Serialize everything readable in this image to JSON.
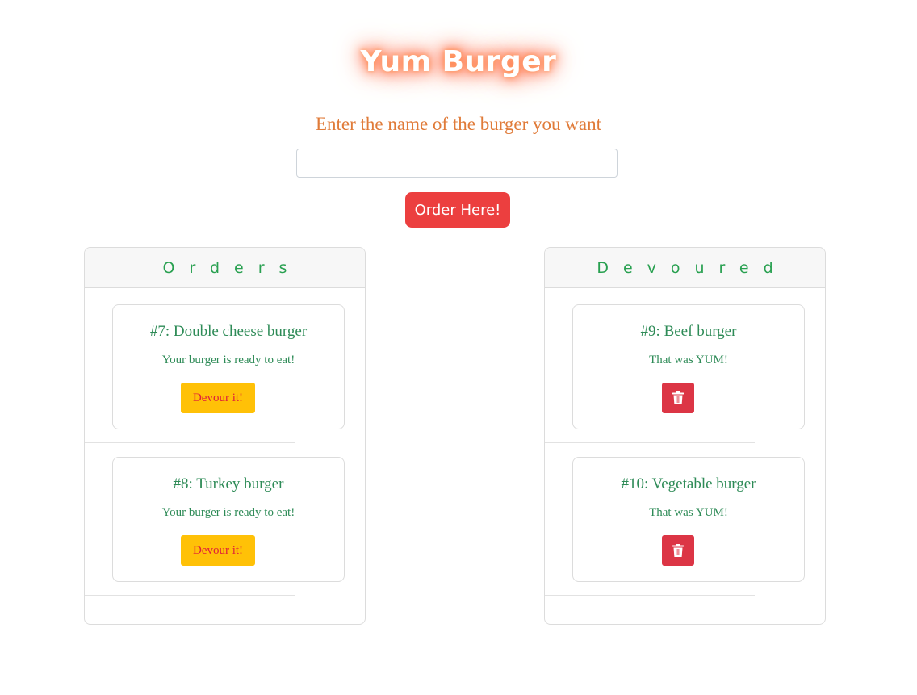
{
  "app": {
    "title": "Yum Burger"
  },
  "order_form": {
    "prompt": "Enter the name of the burger you want",
    "input_value": "",
    "input_placeholder": "",
    "submit_label": "Order Here!"
  },
  "orders": {
    "heading": "Orders",
    "items": [
      {
        "title": "#7: Double cheese burger",
        "status": "Your burger is ready to eat!",
        "action_label": "Devour it!"
      },
      {
        "title": "#8: Turkey burger",
        "status": "Your burger is ready to eat!",
        "action_label": "Devour it!"
      }
    ]
  },
  "devoured": {
    "heading": "Devoured",
    "items": [
      {
        "title": "#9: Beef burger",
        "status": "That was YUM!",
        "action_icon": "trash-icon"
      },
      {
        "title": "#10: Vegetable burger",
        "status": "That was YUM!",
        "action_icon": "trash-icon"
      }
    ]
  },
  "colors": {
    "title_glow": "#ff6a3d",
    "prompt": "#e07b39",
    "order_button": "#ec3f3f",
    "heading_text": "#28a050",
    "card_text": "#2e8b57",
    "devour_button": "#ffc107",
    "devour_button_text": "#e0203a",
    "delete_button": "#dc3545"
  }
}
